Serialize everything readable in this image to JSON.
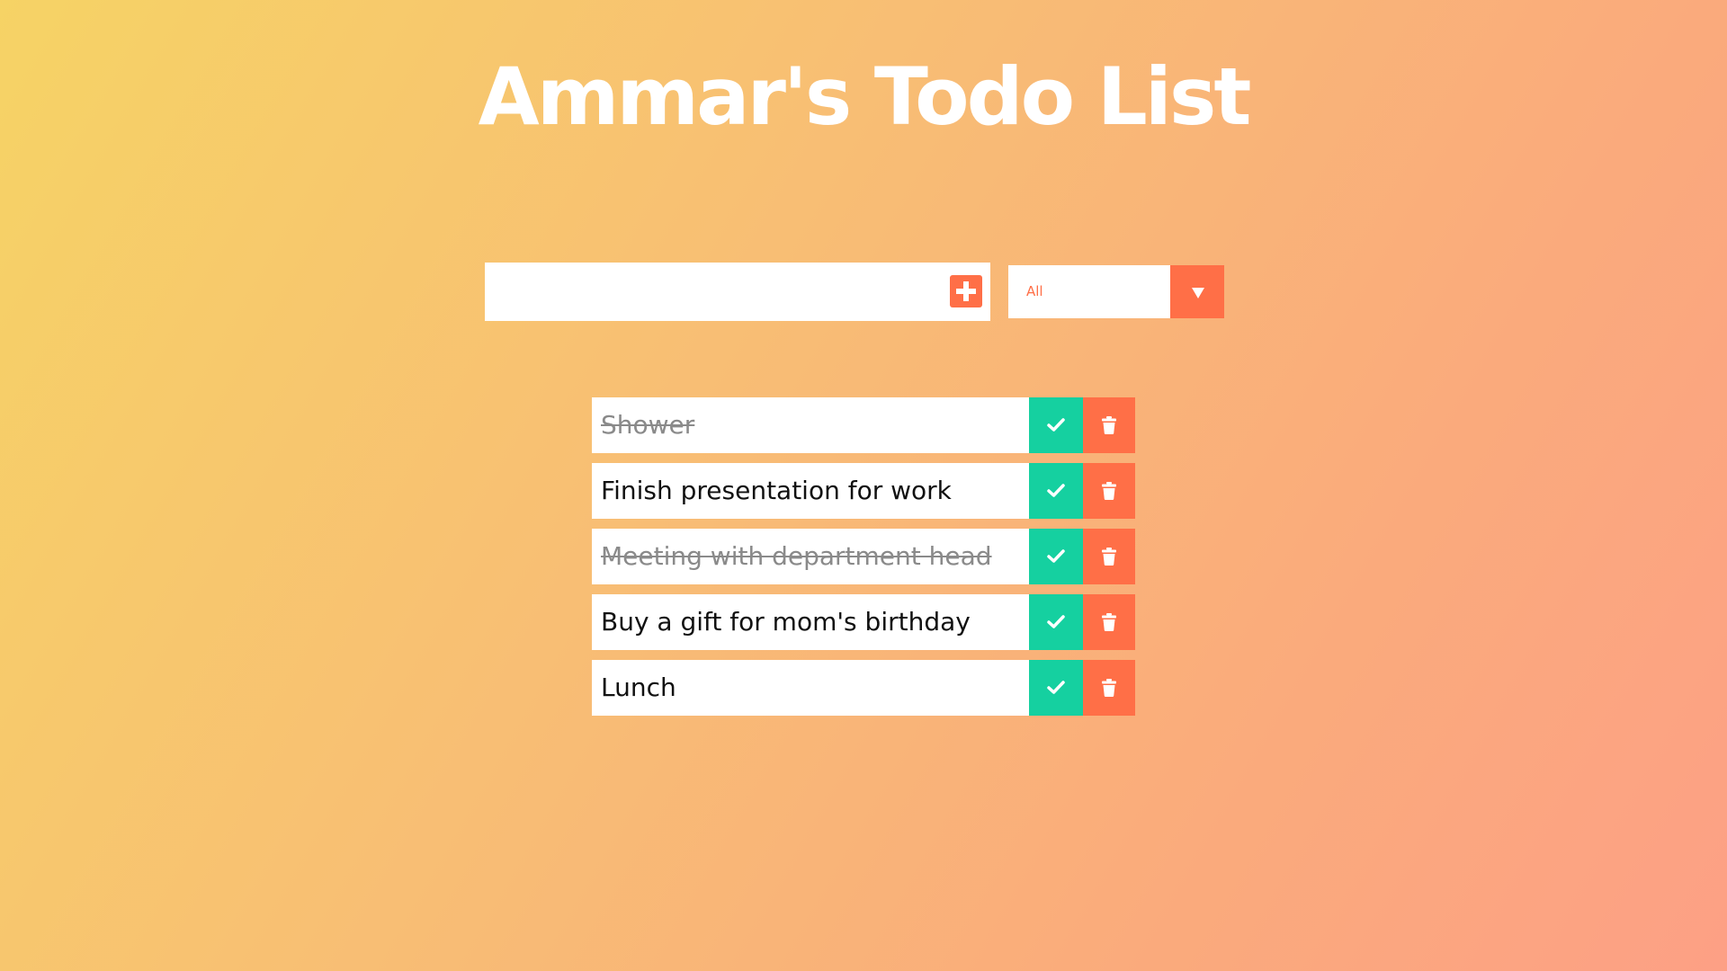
{
  "header": {
    "title": "Ammar's Todo List"
  },
  "form": {
    "input_value": "",
    "input_placeholder": "",
    "add_icon": "plus-square-icon",
    "filter": {
      "selected": "All",
      "options": [
        "All"
      ],
      "arrow_icon": "caret-down-icon"
    }
  },
  "todos": [
    {
      "text": "Shower",
      "completed": true
    },
    {
      "text": "Finish presentation for work",
      "completed": false
    },
    {
      "text": "Meeting with department head",
      "completed": true
    },
    {
      "text": "Buy a gift for mom's birthday",
      "completed": false
    },
    {
      "text": "Lunch",
      "completed": false
    }
  ],
  "item_actions": {
    "complete_icon": "check-icon",
    "delete_icon": "trash-icon"
  },
  "colors": {
    "accent": "#ff6f47",
    "complete": "#15d0a0",
    "gradient_start": "#f6d365",
    "gradient_end": "#fda085"
  }
}
